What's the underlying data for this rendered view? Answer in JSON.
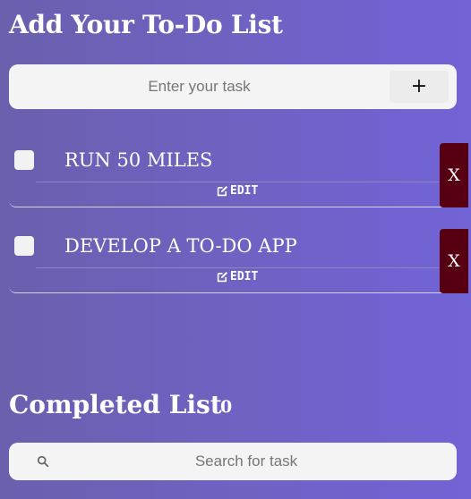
{
  "header": {
    "title": "Add Your To-Do List"
  },
  "add_task": {
    "placeholder": "Enter your task",
    "value": "",
    "button_icon": "plus-icon",
    "button_label": "+"
  },
  "tasks": [
    {
      "text": "RUN 50 MILES",
      "checked": false,
      "edit_label": "EDIT",
      "delete_label": "X"
    },
    {
      "text": "DEVELOP A TO-DO APP",
      "checked": false,
      "edit_label": "EDIT",
      "delete_label": "X"
    }
  ],
  "completed": {
    "title": "Completed List",
    "count": "0"
  },
  "search": {
    "placeholder": "Search for task",
    "value": "",
    "icon": "search-icon"
  },
  "colors": {
    "background_start": "#6a60ad",
    "background_end": "#7263d6",
    "delete_button": "#560011",
    "input_background": "#f4f4f4"
  }
}
